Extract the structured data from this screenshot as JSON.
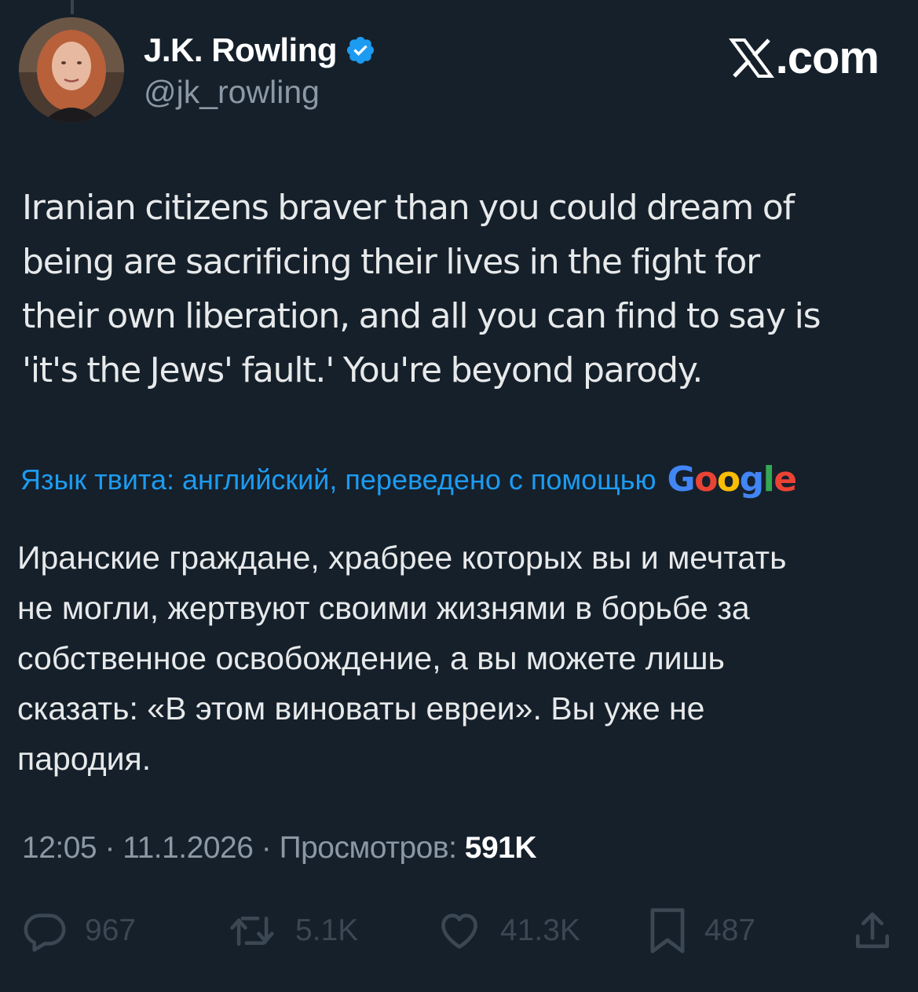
{
  "author": {
    "name": "J.K. Rowling",
    "handle": "@jk_rowling",
    "verified": true
  },
  "brand": {
    "suffix": ".com"
  },
  "tweet": {
    "lines": [
      "Iranian citizens braver than you could dream of",
      "being are sacrificing their lives in the fight for",
      "their own liberation, and all you can find to say is",
      "'it's the Jews' fault.' You're beyond parody."
    ]
  },
  "translation": {
    "note": "Язык твита: английский, переведено с помощью",
    "provider_letters": [
      "G",
      "o",
      "o",
      "g",
      "l",
      "e"
    ],
    "provider_colors": [
      "#4285f4",
      "#ea4335",
      "#fbbc05",
      "#4285f4",
      "#34a853",
      "#ea4335"
    ],
    "lines": [
      "Иранские граждане, храбрее которых вы и мечтать",
      "не могли, жертвуют своими жизнями в борьбе за",
      "собственное освобождение, а вы можете лишь",
      "сказать: «В этом виноваты евреи». Вы уже не",
      "пародия."
    ]
  },
  "meta": {
    "time": "12:05",
    "separator": " · ",
    "date": "11.1.2026",
    "views_label": "Просмотров:",
    "views_count": "591K"
  },
  "actions": {
    "replies": "967",
    "reposts": "5.1K",
    "likes": "41.3K",
    "bookmarks": "487"
  },
  "icons": {
    "verified": "verified-badge-icon",
    "reply": "reply-icon",
    "repost": "repost-icon",
    "like": "heart-icon",
    "bookmark": "bookmark-icon",
    "share": "share-icon"
  },
  "colors": {
    "background": "#15202b",
    "text": "#e7e9ea",
    "muted": "#8b98a5",
    "link": "#1d9bf0",
    "verified": "#1d9bf0",
    "action_icons": "#3b4753"
  }
}
